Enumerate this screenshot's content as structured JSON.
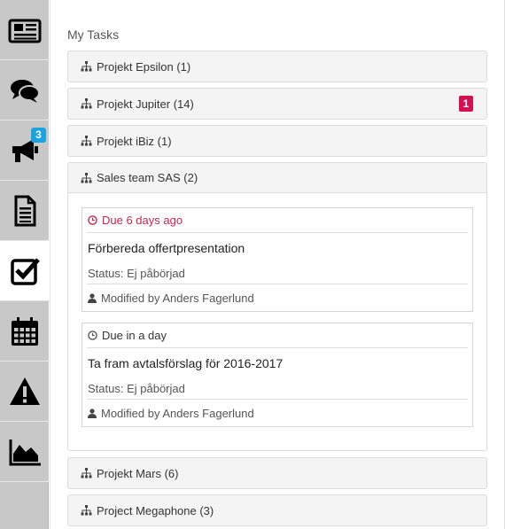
{
  "sidebar": {
    "items": [
      {
        "name": "newspaper-icon"
      },
      {
        "name": "chat-bubbles-icon"
      },
      {
        "name": "megaphone-icon",
        "badge": "3"
      },
      {
        "name": "document-icon"
      },
      {
        "name": "checkbox-icon",
        "active": true
      },
      {
        "name": "calendar-icon"
      },
      {
        "name": "warning-icon"
      },
      {
        "name": "area-chart-icon"
      }
    ]
  },
  "main": {
    "title": "My Tasks",
    "projects": [
      {
        "label": "Projekt Epsilon (1)"
      },
      {
        "label": "Projekt Jupiter (14)",
        "badge": "1"
      },
      {
        "label": "Projekt iBiz (1)"
      },
      {
        "label": "Sales team SAS (2)",
        "expanded": true,
        "tasks": [
          {
            "due": "Due 6 days ago",
            "overdue": true,
            "title": "Förbereda offertpresentation",
            "status": "Status: Ej påbörjad",
            "modified": "Modified by Anders Fagerlund"
          },
          {
            "due": "Due in a day",
            "overdue": false,
            "title": "Ta fram avtalsförslag för 2016-2017",
            "status": "Status: Ej påbörjad",
            "modified": "Modified by Anders Fagerlund"
          }
        ]
      },
      {
        "label": "Projekt Mars (6)"
      },
      {
        "label": "Project Megaphone (3)"
      }
    ]
  },
  "colors": {
    "overdue": "#c8254f",
    "alert_badge": "#d6104e",
    "count_badge": "#1aa3e0",
    "sidebar_bg": "#c8c8c8"
  }
}
